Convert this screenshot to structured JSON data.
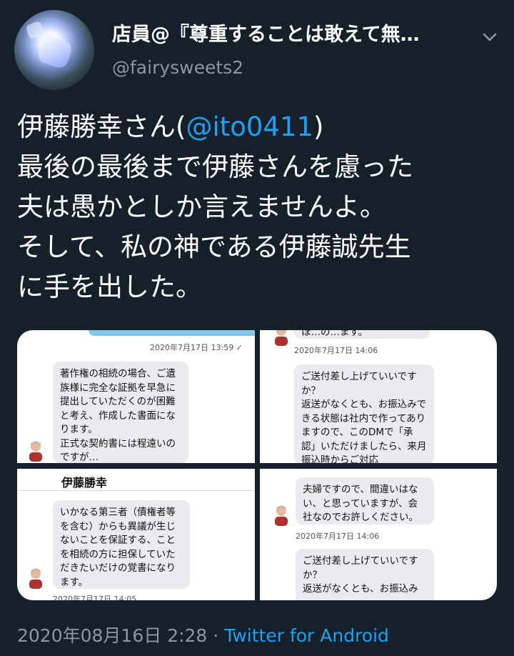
{
  "header": {
    "display_name": "店員@『尊重することは敢えて無…",
    "handle": "@fairysweets2"
  },
  "tweet": {
    "line1_prefix": "伊藤勝幸さん(",
    "mention": "@ito0411",
    "line1_suffix": ")",
    "line2": "最後の最後まで伊藤さんを慮った",
    "line3": "夫は愚かとしか言えませんよ。",
    "line4": "そして、私の神である伊藤誠先生",
    "line5": "に手を出した。"
  },
  "media": {
    "panel1": {
      "timestamp": "2020年7月17日 13:59 ✓",
      "message": "著作権の相続の場合、ご遺族様に完全な証拠を早急に提出していただくのが困難と考え、作成した書面になります。\n正式な契約書には程遠いのですが…"
    },
    "panel2": {
      "top_cut": "ほ…の…ます。",
      "timestamp": "2020年7月17日 14:06",
      "message": "ご送付差し上げていいですか？\n返送がなくとも、お振込みできる状態は社内で作ってありますので、このDMで「承認」いただけましたら、来月振込時からご対応"
    },
    "panel3": {
      "sender_name": "伊藤勝幸",
      "message": "いかなる第三者（債権者等を含む）からも異議が生じないことを保証する、ことを相続の方に担保していただきたいだけの覚書になります。",
      "bottom_cut": "2020年7月17日 14:05"
    },
    "panel4": {
      "message_top": "夫婦ですので、間違いはない、と思っていますが、会社なのでお許しください。",
      "timestamp": "2020年7月17日 14:06",
      "message_bottom": "ご送付差し上げていいですか？\n返送がなくとも、お振込み"
    }
  },
  "footer": {
    "date": "2020年08月16日 2:28 · ",
    "source": "Twitter for Android"
  },
  "colors": {
    "background": "#15202b",
    "secondary_text": "#8899a6",
    "link": "#1da1f2"
  },
  "icons": {
    "chevron": "chevron-down-icon"
  }
}
